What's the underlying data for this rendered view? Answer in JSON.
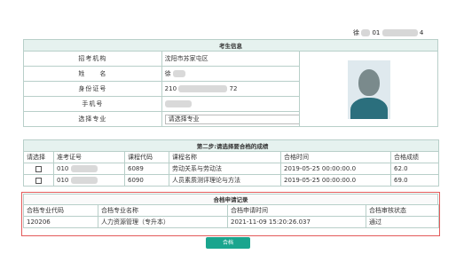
{
  "top_user": {
    "prefix": "徐",
    "code": "01",
    "suffix": "4"
  },
  "info": {
    "title": "考生信息",
    "rows": [
      {
        "label": "招考机构",
        "value": "沈阳市苏家屯区"
      },
      {
        "label": "姓　　名",
        "value": "徐"
      },
      {
        "label": "身份证号",
        "value_prefix": "210",
        "value_suffix": "72"
      },
      {
        "label": "手机号",
        "value": ""
      }
    ],
    "major_label": "选择专业",
    "major_select_value": "请选择专业"
  },
  "scores": {
    "title": "第二步:请选择要合档的成绩",
    "headers": [
      "请选择",
      "准考证号",
      "课程代码",
      "课程名称",
      "合格时间",
      "合格成绩"
    ],
    "rows": [
      {
        "exam_no": "010",
        "course_code": "6089",
        "course_name": "劳动关系与劳动法",
        "pass_time": "2019-05-25 00:00:00.0",
        "score": "62.0"
      },
      {
        "exam_no": "010",
        "course_code": "6090",
        "course_name": "人员素质测评理论与方法",
        "pass_time": "2019-05-25 00:00:00.0",
        "score": "69.0"
      }
    ]
  },
  "apply": {
    "title": "合档申请记录",
    "headers": [
      "合档专业代码",
      "合档专业名称",
      "合档申请时间",
      "合档审核状态"
    ],
    "rows": [
      {
        "code": "120206",
        "name": "人力资源管理（专升本）",
        "time": "2021-11-09 15:20:26.037",
        "status": "通过"
      }
    ]
  },
  "submit_label": "合档",
  "colors": {
    "accent": "#1aa58e",
    "header_bg": "#e6f2ef",
    "border": "#b8cfc9",
    "highlight": "#e35a5a"
  }
}
